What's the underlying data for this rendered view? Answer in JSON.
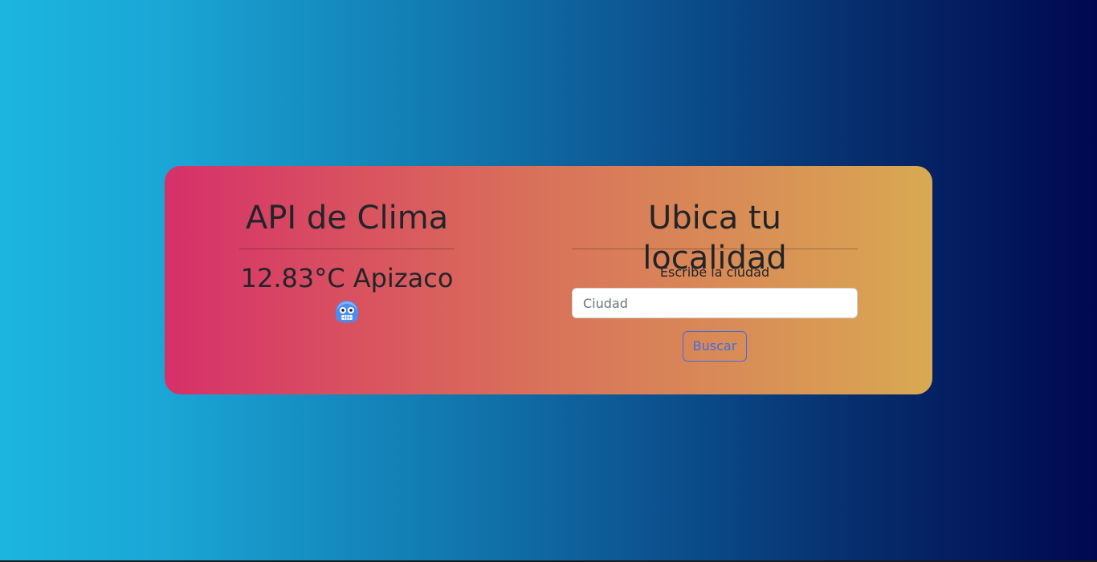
{
  "weather": {
    "title": "API de Clima",
    "reading": "12.83°C Apizaco",
    "condition_icon": "freezing-face-icon"
  },
  "search": {
    "title": "Ubica tu localidad",
    "label": "Escribe la ciudad",
    "placeholder": "Ciudad",
    "value": "",
    "button_label": "Buscar"
  },
  "colors": {
    "background_left": "#1cb5e0",
    "background_right": "#000850",
    "card_left": "#d6306a",
    "card_right": "#d9a952",
    "button_accent": "#3d6fe0"
  }
}
